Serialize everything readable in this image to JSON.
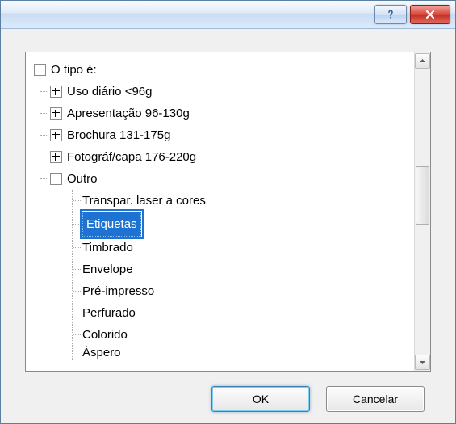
{
  "tree": {
    "root_label": "O tipo é:",
    "items": [
      {
        "label": "Uso diário <96g",
        "expand": "plus"
      },
      {
        "label": "Apresentação 96-130g",
        "expand": "plus"
      },
      {
        "label": "Brochura 131-175g",
        "expand": "plus"
      },
      {
        "label": "Fotográf/capa 176-220g",
        "expand": "plus"
      },
      {
        "label": "Outro",
        "expand": "minus"
      }
    ],
    "outro_children": [
      {
        "label": "Transpar. laser a cores"
      },
      {
        "label": "Etiquetas",
        "selected": true
      },
      {
        "label": "Timbrado"
      },
      {
        "label": "Envelope"
      },
      {
        "label": "Pré-impresso"
      },
      {
        "label": "Perfurado"
      },
      {
        "label": "Colorido"
      },
      {
        "label": "Áspero",
        "cut": true
      }
    ]
  },
  "buttons": {
    "ok": "OK",
    "cancel": "Cancelar"
  }
}
